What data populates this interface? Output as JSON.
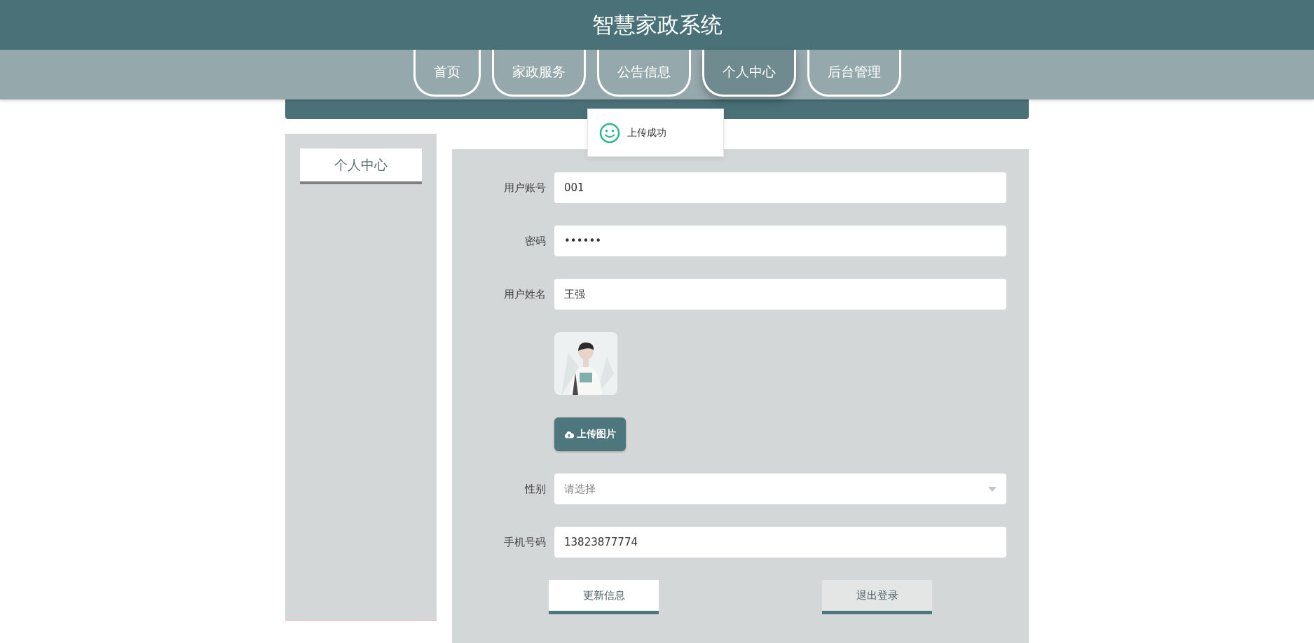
{
  "header": {
    "title": "智慧家政系统"
  },
  "nav": [
    {
      "label": "首页",
      "selected": false
    },
    {
      "label": "家政服务",
      "selected": false
    },
    {
      "label": "公告信息",
      "selected": false
    },
    {
      "label": "个人中心",
      "selected": true
    },
    {
      "label": "后台管理",
      "selected": false
    }
  ],
  "toast": {
    "message": "上传成功"
  },
  "sidebar": {
    "items": [
      {
        "label": "个人中心",
        "selected": true
      }
    ]
  },
  "form": {
    "fields": [
      {
        "kind": "text",
        "label": "用户账号",
        "value": "001"
      },
      {
        "kind": "text",
        "label": "密码",
        "value": "••••••"
      },
      {
        "kind": "text",
        "label": "用户姓名",
        "value": "王强"
      },
      {
        "upload_label": "上传图片"
      },
      {
        "kind": "select",
        "label": "性别",
        "placeholder": "请选择"
      },
      {
        "kind": "text",
        "label": "手机号码",
        "value": "13823877774"
      }
    ],
    "buttons": [
      {
        "kind": "primary",
        "label": "更新信息"
      },
      {
        "kind": "secondary",
        "label": "退出登录"
      }
    ]
  }
}
